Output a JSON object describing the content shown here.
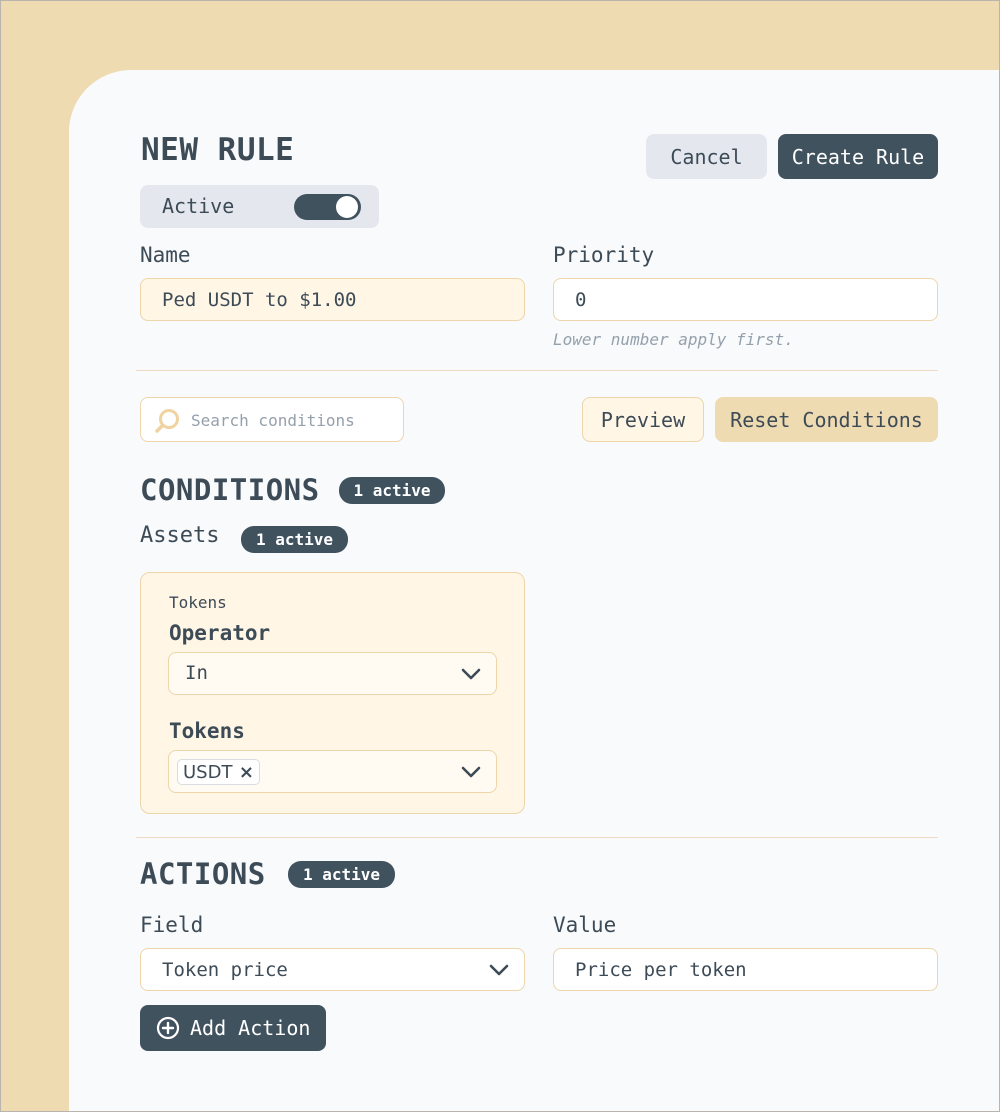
{
  "header": {
    "title": "NEW RULE",
    "cancel_label": "Cancel",
    "create_label": "Create Rule"
  },
  "status": {
    "active_label": "Active",
    "active_on": true
  },
  "form": {
    "name_label": "Name",
    "name_value": "Ped USDT to $1.00",
    "priority_label": "Priority",
    "priority_value": "0",
    "priority_hint": "Lower number apply first."
  },
  "toolbar": {
    "search_placeholder": "Search conditions",
    "preview_label": "Preview",
    "reset_label": "Reset Conditions"
  },
  "conditions": {
    "title": "CONDITIONS",
    "badge": "1 active",
    "group_title": "Assets",
    "group_badge": "1 active",
    "card": {
      "caption": "Tokens",
      "operator_label": "Operator",
      "operator_value": "In",
      "tokens_label": "Tokens",
      "tokens": [
        "USDT"
      ],
      "chip_remove": "×"
    }
  },
  "actions": {
    "title": "ACTIONS",
    "badge": "1 active",
    "field_label": "Field",
    "field_value": "Token price",
    "value_label": "Value",
    "value_value": "Price per token",
    "add_label": "Add Action"
  },
  "colors": {
    "background": "#efdbb2",
    "panel": "#f8fafc",
    "primary": "#41525f",
    "accent_border": "#eed5aa",
    "accent_fill": "#fff6e6"
  },
  "icons": {
    "search": "search-icon",
    "chevron": "chevron-down-icon",
    "plus": "plus-circle-icon",
    "remove": "close-icon"
  }
}
